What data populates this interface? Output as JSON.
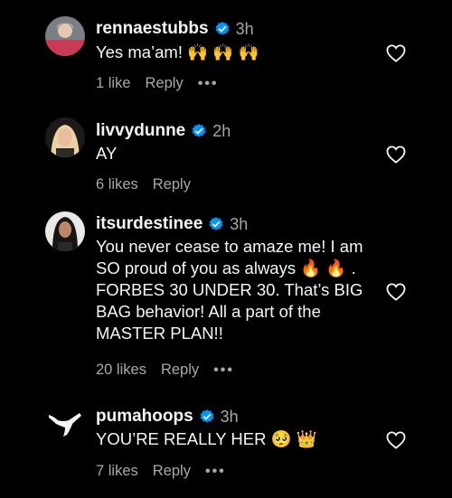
{
  "comments": [
    {
      "username": "rennaestubbs",
      "time": "3h",
      "text": "Yes ma’am! 🙌 🙌 🙌",
      "likes": "1 like",
      "reply": "Reply",
      "more": "•••"
    },
    {
      "username": "livvydunne",
      "time": "2h",
      "text": "AY",
      "likes": "6 likes",
      "reply": "Reply",
      "more": ""
    },
    {
      "username": "itsurdestinee",
      "time": "3h",
      "text": "You never cease to amaze me! I am SO proud of you as always 🔥 🔥 . FORBES 30 UNDER 30. That’s BIG BAG behavior! All a part of the MASTER PLAN!!",
      "likes": "20 likes",
      "reply": "Reply",
      "more": "•••"
    },
    {
      "username": "pumahoops",
      "time": "3h",
      "text": "YOU’RE REALLY HER 🥺 👑",
      "likes": "7 likes",
      "reply": "Reply",
      "more": "•••"
    }
  ],
  "colors": {
    "background": "#000000",
    "text": "#f5f5f5",
    "muted": "#a8a8a8",
    "verified": "#0095f6"
  },
  "icons": {
    "verified": "verified-badge-icon",
    "like": "heart-outline-icon",
    "more": "more-dots-icon"
  }
}
